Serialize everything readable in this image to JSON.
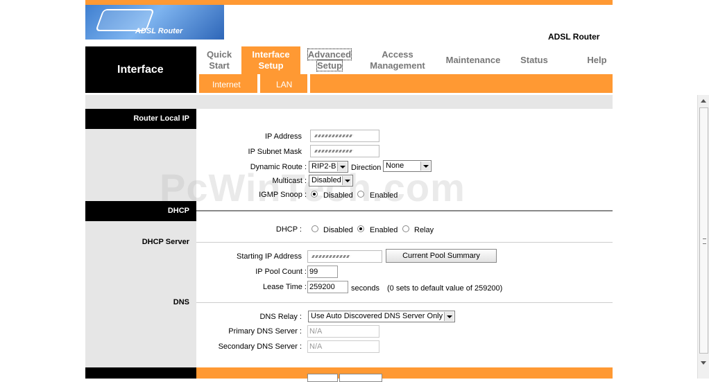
{
  "header": {
    "logo_text": "ADSL Router",
    "product": "ADSL Router"
  },
  "nav": {
    "section": "Interface",
    "menu": [
      {
        "line1": "Quick",
        "line2": "Start"
      },
      {
        "line1": "Interface",
        "line2": "Setup"
      },
      {
        "line1": "Advanced",
        "line2": "Setup"
      },
      {
        "line1": "Access",
        "line2": "Management"
      },
      {
        "line1": "Maintenance",
        "line2": ""
      },
      {
        "line1": "Status",
        "line2": ""
      },
      {
        "line1": "Help",
        "line2": ""
      }
    ],
    "submenu": [
      "Internet",
      "LAN"
    ]
  },
  "sections": {
    "router_local_ip": "Router Local IP",
    "dhcp": "DHCP",
    "dhcp_server": "DHCP Server",
    "dns": "DNS"
  },
  "router": {
    "ip_address_label": "IP Address",
    "subnet_label": "IP Subnet Mask",
    "dynamic_route_label": "Dynamic Route :",
    "dynamic_route_value": "RIP2-B",
    "direction_label": "Direction",
    "direction_value": "None",
    "multicast_label": "Multicast :",
    "multicast_value": "Disabled",
    "igmp_label": "IGMP Snoop :",
    "igmp_disabled": "Disabled",
    "igmp_enabled": "Enabled"
  },
  "dhcp": {
    "label": "DHCP :",
    "opt_disabled": "Disabled",
    "opt_enabled": "Enabled",
    "opt_relay": "Relay",
    "start_ip_label": "Starting IP Address",
    "pool_summary_button": "Current Pool Summary",
    "pool_count_label": "IP Pool Count :",
    "pool_count_value": "99",
    "lease_label": "Lease Time :",
    "lease_value": "259200",
    "lease_unit": "seconds",
    "lease_note": "(0 sets to default value of 259200)"
  },
  "dns": {
    "relay_label": "DNS Relay :",
    "relay_value": "Use Auto Discovered DNS Server Only",
    "primary_label": "Primary DNS Server :",
    "primary_value": "N/A",
    "secondary_label": "Secondary DNS Server :",
    "secondary_value": "N/A"
  },
  "watermark": "PcWinTech.com",
  "colors": {
    "accent": "#ff9933",
    "header_black": "#000000",
    "panel_gray": "#e6e6e6"
  }
}
